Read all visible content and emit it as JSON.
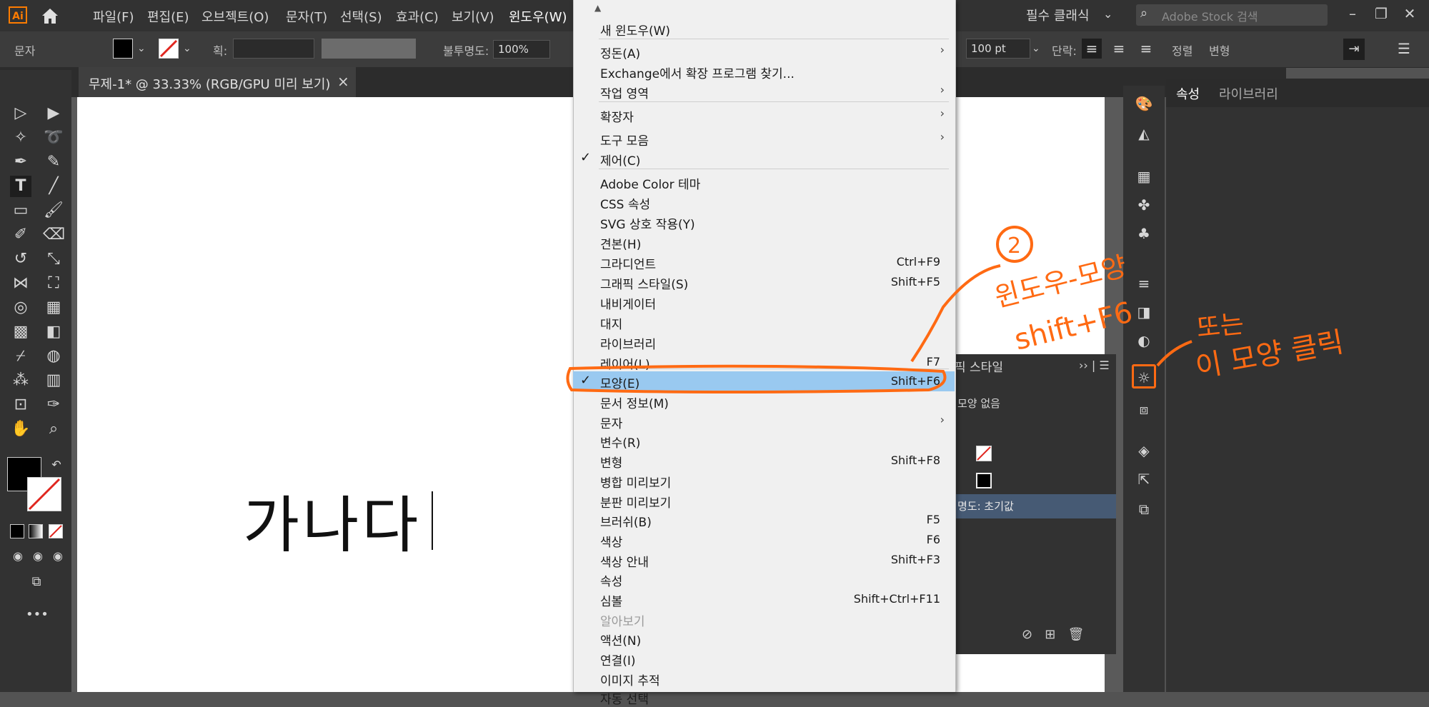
{
  "app": {
    "logo_text": "Ai"
  },
  "menubar": {
    "items": [
      "파일(F)",
      "편집(E)",
      "오브젝트(O)",
      "문자(T)",
      "선택(S)",
      "효과(C)",
      "보기(V)",
      "윈도우(W)"
    ],
    "workspace": "필수 클래식",
    "stock_placeholder": "Adobe Stock 검색"
  },
  "control": {
    "tool_label": "문자",
    "stroke_label": "획:",
    "opacity_label": "불투명도:",
    "opacity_value": "100%",
    "font_size": "100 pt",
    "paragraph_label": "단락:",
    "align_label": "정렬",
    "transform_label": "변형"
  },
  "document": {
    "tab_title": "무제-1* @ 33.33% (RGB/GPU 미리 보기)",
    "artboard_text": "가나다"
  },
  "window_menu": {
    "items": [
      {
        "label": "새 윈도우(W)"
      },
      {
        "label": "정돈(A)",
        "submenu": true
      },
      {
        "label": "Exchange에서 확장 프로그램 찾기..."
      },
      {
        "label": "작업 영역",
        "submenu": true
      },
      {
        "label": "확장자",
        "submenu": true
      },
      {
        "label": "도구 모음",
        "submenu": true
      },
      {
        "label": "제어(C)",
        "checked": true
      },
      {
        "label": "Adobe Color 테마"
      },
      {
        "label": "CSS 속성"
      },
      {
        "label": "SVG 상호 작용(Y)"
      },
      {
        "label": "견본(H)"
      },
      {
        "label": "그라디언트",
        "shortcut": "Ctrl+F9"
      },
      {
        "label": "그래픽 스타일(S)",
        "shortcut": "Shift+F5"
      },
      {
        "label": "내비게이터"
      },
      {
        "label": "대지"
      },
      {
        "label": "라이브러리"
      },
      {
        "label": "레이어(L)",
        "shortcut": "F7"
      },
      {
        "label": "모양(E)",
        "shortcut": "Shift+F6",
        "checked": true,
        "highlight": true
      },
      {
        "label": "문서 정보(M)"
      },
      {
        "label": "문자",
        "submenu": true
      },
      {
        "label": "변수(R)"
      },
      {
        "label": "변형",
        "shortcut": "Shift+F8"
      },
      {
        "label": "병합 미리보기"
      },
      {
        "label": "분판 미리보기"
      },
      {
        "label": "브러쉬(B)",
        "shortcut": "F5"
      },
      {
        "label": "색상",
        "shortcut": "F6"
      },
      {
        "label": "색상 안내",
        "shortcut": "Shift+F3"
      },
      {
        "label": "속성"
      },
      {
        "label": "심볼",
        "shortcut": "Shift+Ctrl+F11"
      },
      {
        "label": "알아보기",
        "disabled": true
      },
      {
        "label": "액션(N)"
      },
      {
        "label": "연결(I)"
      },
      {
        "label": "이미지 추적"
      },
      {
        "label": "자동 선택"
      }
    ]
  },
  "appearance_panel": {
    "tab_label": "픽 스타일",
    "no_appearance": "모양 없음",
    "opacity_row": "명도: 초기값"
  },
  "properties_panel": {
    "tabs": [
      "속성",
      "라이브러리"
    ]
  },
  "annotation": {
    "circle_number": "2",
    "line1": "윈도우-모양",
    "line2": "shift+F6",
    "line3": "또는",
    "line4": "이 모양 클릭",
    "color": "#ff6a13"
  },
  "colors": {
    "menu_highlight": "#99c9f0",
    "accent_orange": "#ff6a13",
    "ui_dark": "#323232"
  }
}
